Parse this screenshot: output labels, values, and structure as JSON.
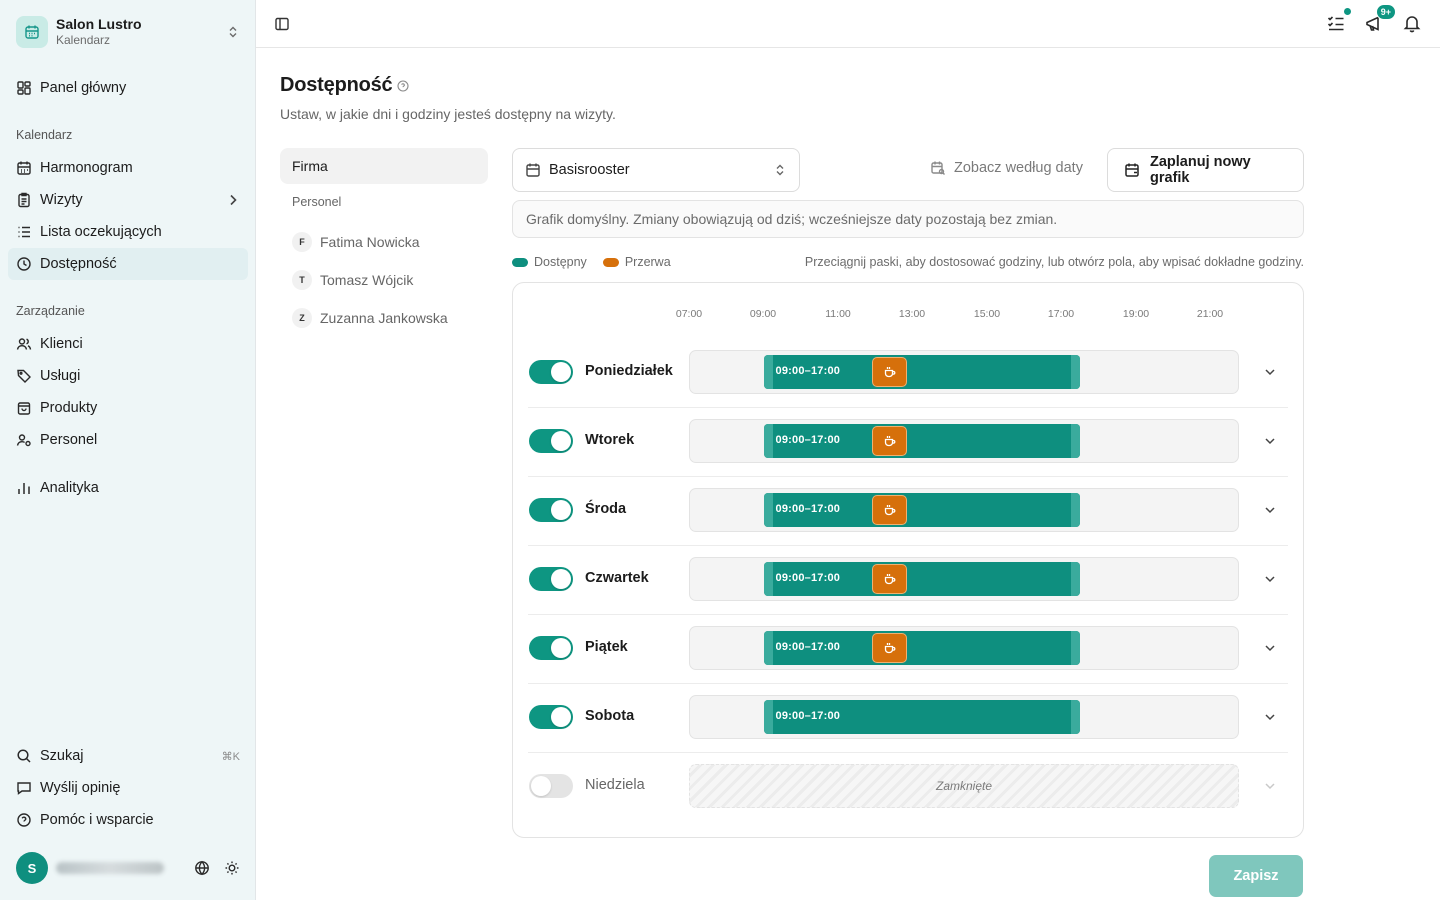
{
  "org": {
    "name": "Salon Lustro",
    "subtitle": "Kalendarz"
  },
  "sidebar": {
    "top_items": [
      {
        "label": "Panel główny"
      }
    ],
    "sections": [
      {
        "title": "Kalendarz",
        "items": [
          {
            "label": "Harmonogram"
          },
          {
            "label": "Wizyty"
          },
          {
            "label": "Lista oczekujących"
          },
          {
            "label": "Dostępność",
            "active": true
          }
        ]
      },
      {
        "title": "Zarządzanie",
        "items": [
          {
            "label": "Klienci"
          },
          {
            "label": "Usługi"
          },
          {
            "label": "Produkty"
          },
          {
            "label": "Personel"
          }
        ]
      }
    ],
    "analytics": {
      "label": "Analityka"
    },
    "bottom": [
      {
        "label": "Szukaj",
        "shortcut": "⌘K"
      },
      {
        "label": "Wyślij opinię"
      },
      {
        "label": "Pomóc i wsparcie"
      }
    ],
    "user": {
      "initial": "S"
    }
  },
  "topbar": {
    "notifications_badge": "9+"
  },
  "page": {
    "title": "Dostępność",
    "subtitle": "Ustaw, w jakie dni i godziny jesteś dostępny na wizyty."
  },
  "left_panel": {
    "firma": "Firma",
    "section": "Personel",
    "people": [
      {
        "initial": "F",
        "name": "Fatima Nowicka"
      },
      {
        "initial": "T",
        "name": "Tomasz Wójcik"
      },
      {
        "initial": "Z",
        "name": "Zuzanna Jankowska"
      }
    ]
  },
  "schedule": {
    "selected": "Basisrooster",
    "by_date_label": "Zobacz według daty",
    "plan_label": "Zaplanuj nowy grafik",
    "info": "Grafik domyślny. Zmiany obowiązują od dziś; wcześniejsze daty pozostają bez zmian.",
    "legend": {
      "available": "Dostępny",
      "break": "Przerwa"
    },
    "legend_colors": {
      "available": "#0e8f7f",
      "break": "#d6700b"
    },
    "hint": "Przeciągnij paski, aby dostosować godziny, lub otwórz pola, aby wpisać dokładne godziny."
  },
  "chart_data": {
    "type": "timeline",
    "x_ticks": [
      "07:00",
      "09:00",
      "11:00",
      "13:00",
      "15:00",
      "17:00",
      "19:00",
      "21:00"
    ],
    "days": [
      {
        "name": "Poniedziałek",
        "enabled": true,
        "start": "09:00",
        "end": "17:00",
        "label": "09:00–17:00",
        "break": "12:00"
      },
      {
        "name": "Wtorek",
        "enabled": true,
        "start": "09:00",
        "end": "17:00",
        "label": "09:00–17:00",
        "break": "12:00"
      },
      {
        "name": "Środa",
        "enabled": true,
        "start": "09:00",
        "end": "17:00",
        "label": "09:00–17:00",
        "break": "12:00"
      },
      {
        "name": "Czwartek",
        "enabled": true,
        "start": "09:00",
        "end": "17:00",
        "label": "09:00–17:00",
        "break": "12:00"
      },
      {
        "name": "Piątek",
        "enabled": true,
        "start": "09:00",
        "end": "17:00",
        "label": "09:00–17:00",
        "break": "12:00"
      },
      {
        "name": "Sobota",
        "enabled": true,
        "start": "09:00",
        "end": "17:00",
        "label": "09:00–17:00",
        "break": null
      },
      {
        "name": "Niedziela",
        "enabled": false,
        "closed_label": "Zamknięte"
      }
    ]
  },
  "actions": {
    "save": "Zapisz"
  }
}
